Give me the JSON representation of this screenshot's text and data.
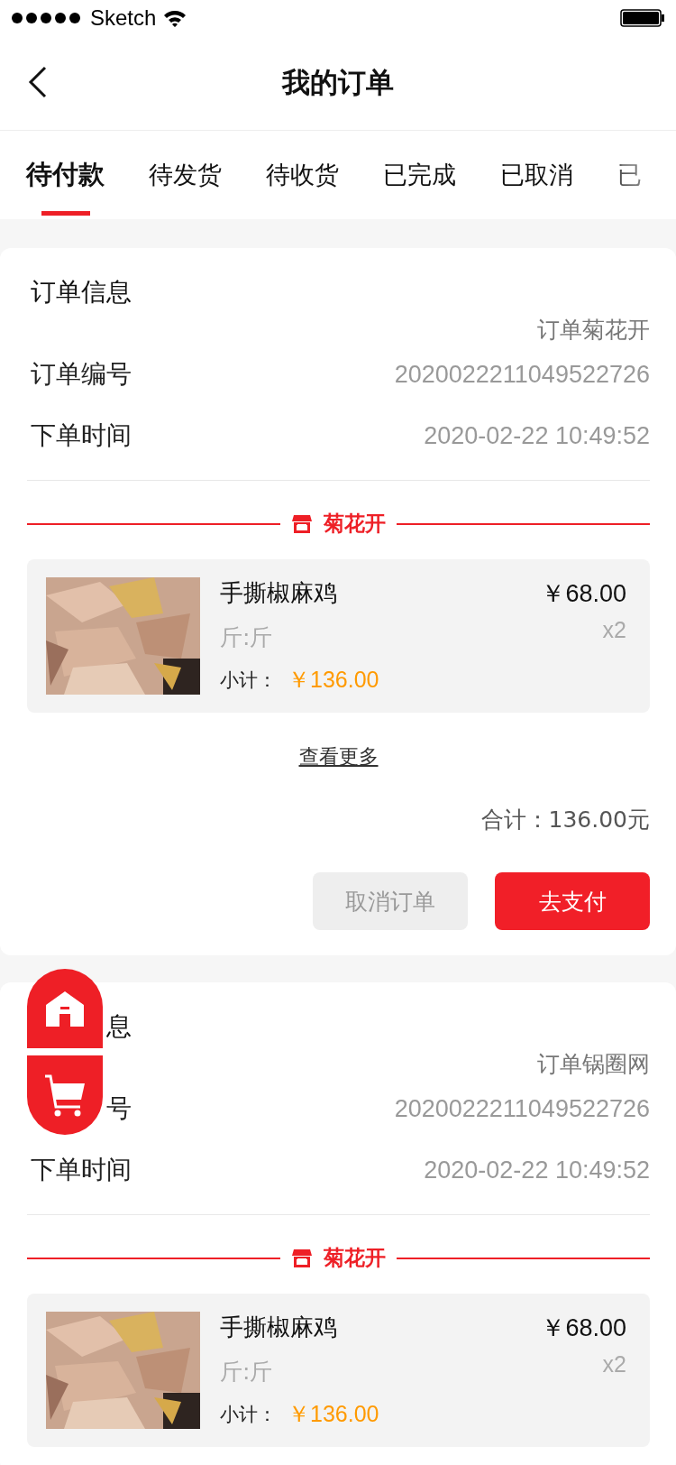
{
  "status_bar": {
    "carrier": "Sketch"
  },
  "header": {
    "title": "我的订单"
  },
  "tabs": [
    {
      "label": "待付款",
      "selected": true
    },
    {
      "label": "待发货",
      "selected": false
    },
    {
      "label": "待收货",
      "selected": false
    },
    {
      "label": "已完成",
      "selected": false
    },
    {
      "label": "已取消",
      "selected": false
    },
    {
      "label": "已",
      "selected": false
    }
  ],
  "orders": [
    {
      "title": "订单信息",
      "shop_label": "订单菊花开",
      "fields": [
        {
          "label": "订单编号",
          "value": "2020022211049522726"
        },
        {
          "label": "下单时间",
          "value": "2020-02-22 10:49:52"
        }
      ],
      "store": "菊花开",
      "items": [
        {
          "name": "手撕椒麻鸡",
          "spec": "斤:斤",
          "price": "￥68.00",
          "qty": "x2",
          "subtotal_label": "小计：",
          "subtotal": "￥136.00"
        }
      ],
      "more": "查看更多",
      "total": "合计：136.00元",
      "buttons": [
        {
          "label": "取消订单",
          "kind": "secondary"
        },
        {
          "label": "去支付",
          "kind": "primary"
        }
      ]
    },
    {
      "title": "息",
      "shop_label": "订单锅圈网",
      "fields": [
        {
          "label": "号",
          "value": "2020022211049522726"
        },
        {
          "label": "下单时间",
          "value": "2020-02-22 10:49:52"
        }
      ],
      "store": "菊花开",
      "items": [
        {
          "name": "手撕椒麻鸡",
          "spec": "斤:斤",
          "price": "￥68.00",
          "qty": "x2",
          "subtotal_label": "小计：",
          "subtotal": "￥136.00"
        }
      ]
    }
  ]
}
